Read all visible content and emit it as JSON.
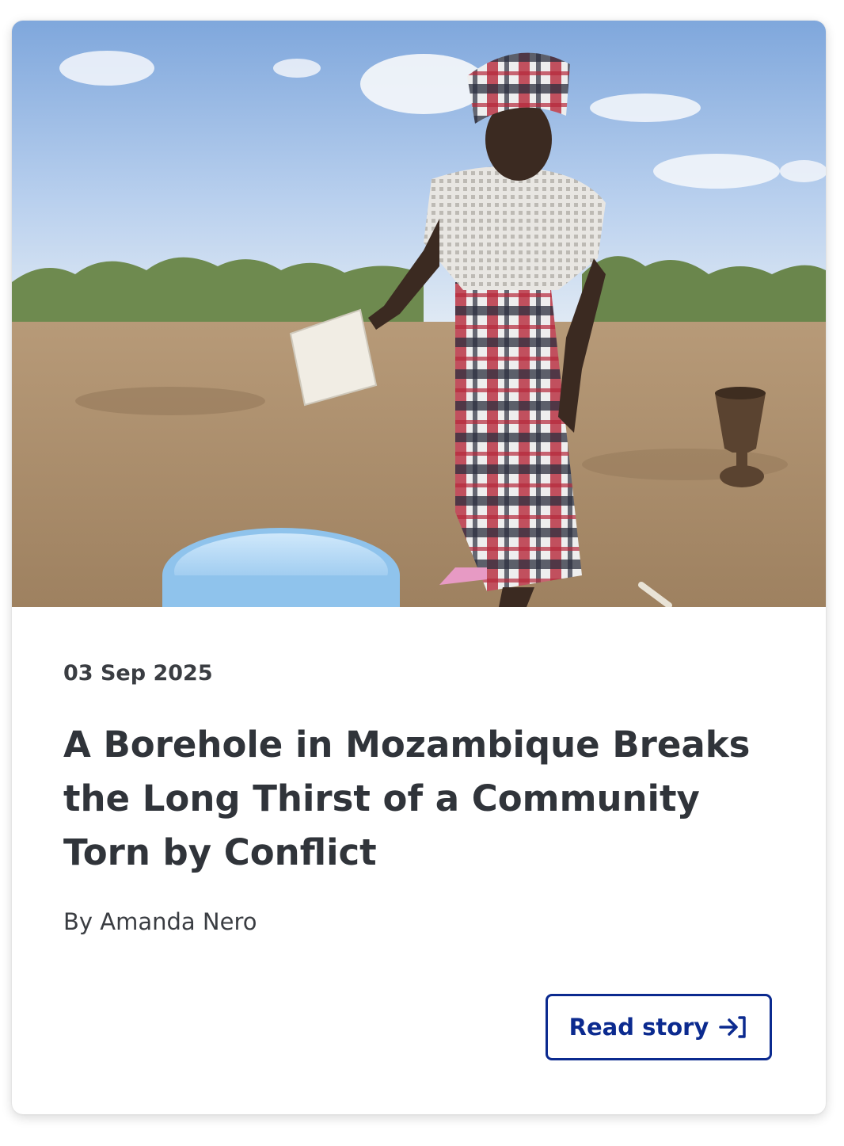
{
  "story": {
    "date": "03 Sep 2025",
    "title": "A Borehole in Mozambique Breaks the Long Thirst of a Community Torn by Conflict",
    "byline_prefix": "By",
    "author": "Amanda Nero",
    "cta_label": "Read story",
    "cta_icon": "arrow-right-to-bracket-icon"
  },
  "colors": {
    "accent": "#0b2a8f",
    "text": "#30343a",
    "card_bg": "#ffffff"
  }
}
